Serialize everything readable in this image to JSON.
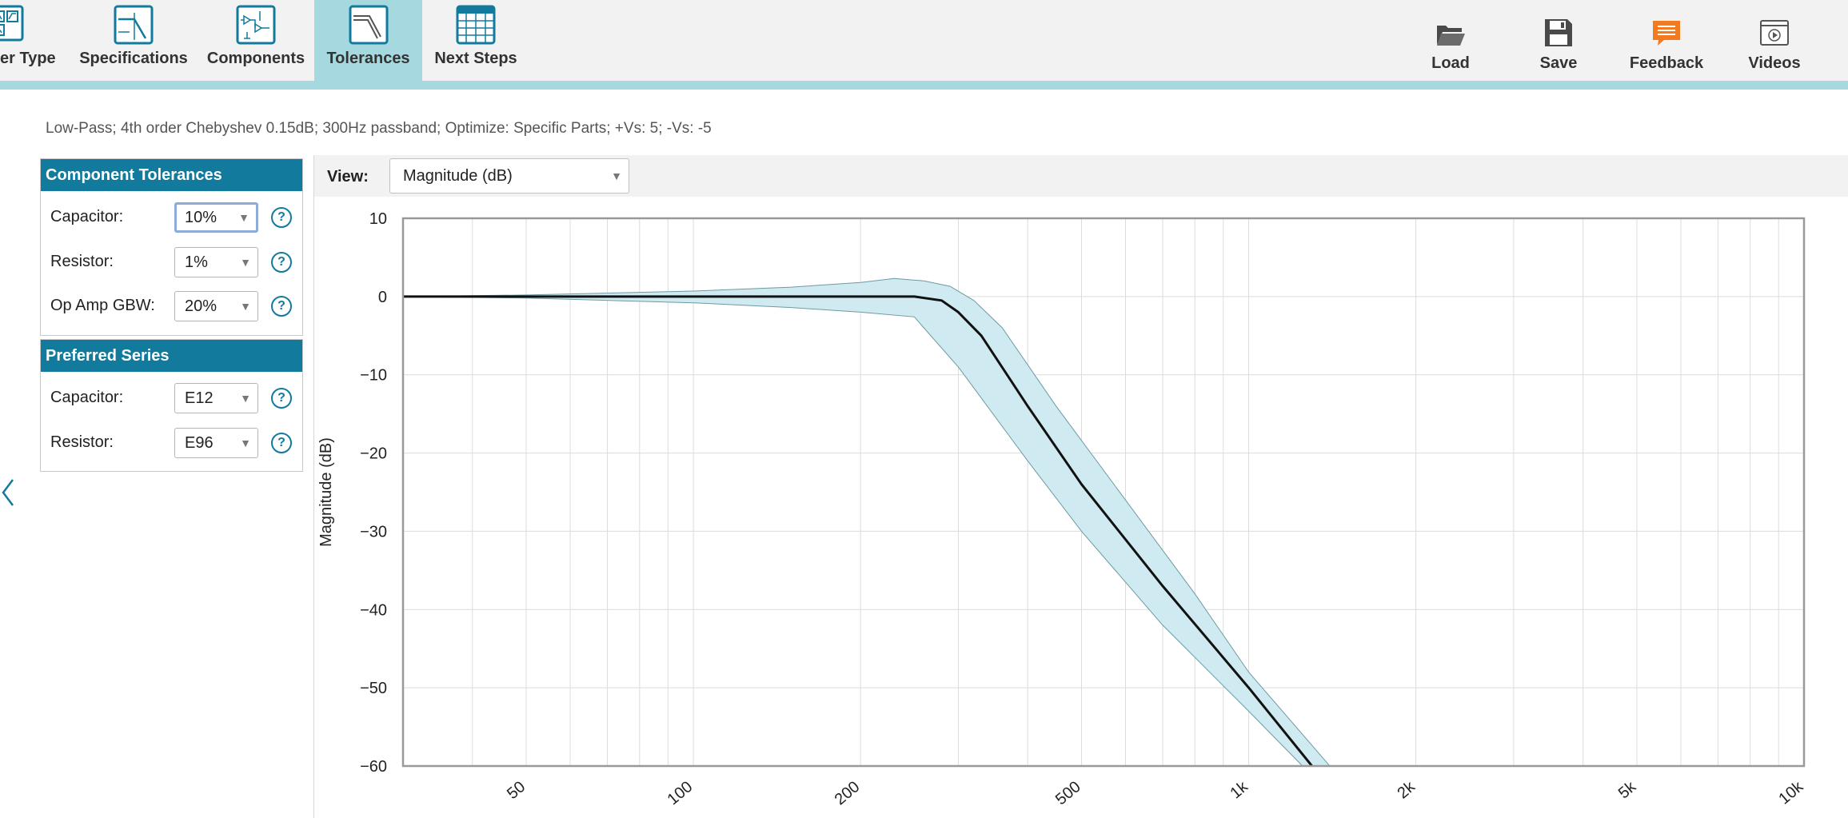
{
  "tabs": [
    {
      "label": "er Type",
      "icon": "filter-type-icon",
      "active": false
    },
    {
      "label": "Specifications",
      "icon": "specifications-icon",
      "active": false
    },
    {
      "label": "Components",
      "icon": "components-icon",
      "active": false
    },
    {
      "label": "Tolerances",
      "icon": "tolerances-icon",
      "active": true
    },
    {
      "label": "Next Steps",
      "icon": "next-steps-icon",
      "active": false
    }
  ],
  "actions": [
    {
      "label": "Load",
      "icon": "folder-icon"
    },
    {
      "label": "Save",
      "icon": "floppy-disk-icon"
    },
    {
      "label": "Feedback",
      "icon": "feedback-icon"
    },
    {
      "label": "Videos",
      "icon": "video-icon"
    }
  ],
  "summary": "Low-Pass; 4th order Chebyshev 0.15dB; 300Hz passband; Optimize: Specific Parts; +Vs: 5; -Vs: -5",
  "component_tolerances": {
    "title": "Component Tolerances",
    "rows": [
      {
        "label": "Capacitor:",
        "value": "10%"
      },
      {
        "label": "Resistor:",
        "value": "1%"
      },
      {
        "label": "Op Amp GBW:",
        "value": "20%"
      }
    ]
  },
  "preferred_series": {
    "title": "Preferred Series",
    "rows": [
      {
        "label": "Capacitor:",
        "value": "E12"
      },
      {
        "label": "Resistor:",
        "value": "E96"
      }
    ]
  },
  "view": {
    "label": "View:",
    "selected": "Magnitude (dB)"
  },
  "colors": {
    "accent": "#127a9c",
    "active_tab": "#a5d8df",
    "band": "#cfeaf0",
    "feedback": "#f47a20"
  },
  "chart_data": {
    "type": "line",
    "ylabel": "Magnitude (dB)",
    "xscale": "log",
    "xlim": [
      30,
      10000
    ],
    "ylim": [
      -60,
      10
    ],
    "yticks": [
      10,
      0,
      -10,
      -20,
      -30,
      -40,
      -50,
      -60
    ],
    "xtick_labels": [
      {
        "value": 50,
        "label": "50"
      },
      {
        "value": 100,
        "label": "100"
      },
      {
        "value": 200,
        "label": "200"
      },
      {
        "value": 500,
        "label": "500"
      },
      {
        "value": 1000,
        "label": "1k"
      },
      {
        "value": 2000,
        "label": "2k"
      },
      {
        "value": 5000,
        "label": "5k"
      },
      {
        "value": 10000,
        "label": "10k"
      }
    ],
    "series": [
      {
        "role": "nominal",
        "x": [
          30,
          50,
          100,
          150,
          200,
          250,
          280,
          300,
          330,
          400,
          500,
          700,
          1000,
          1300
        ],
        "y": [
          0,
          0,
          0,
          0,
          0,
          0,
          -0.5,
          -2,
          -5,
          -14,
          -24,
          -37,
          -50,
          -60
        ]
      },
      {
        "role": "upper",
        "x": [
          30,
          50,
          100,
          150,
          200,
          230,
          260,
          290,
          320,
          360,
          450,
          600,
          800,
          1000,
          1400
        ],
        "y": [
          0,
          0.2,
          0.7,
          1.2,
          1.8,
          2.3,
          2,
          1.3,
          -0.5,
          -4,
          -14,
          -26,
          -38,
          -48,
          -60
        ]
      },
      {
        "role": "lower",
        "x": [
          30,
          50,
          100,
          150,
          200,
          250,
          260,
          300,
          400,
          500,
          700,
          1000,
          1250
        ],
        "y": [
          0,
          -0.2,
          -0.8,
          -1.4,
          -2.0,
          -2.6,
          -4,
          -9,
          -21,
          -30,
          -42,
          -53,
          -60
        ]
      }
    ]
  }
}
